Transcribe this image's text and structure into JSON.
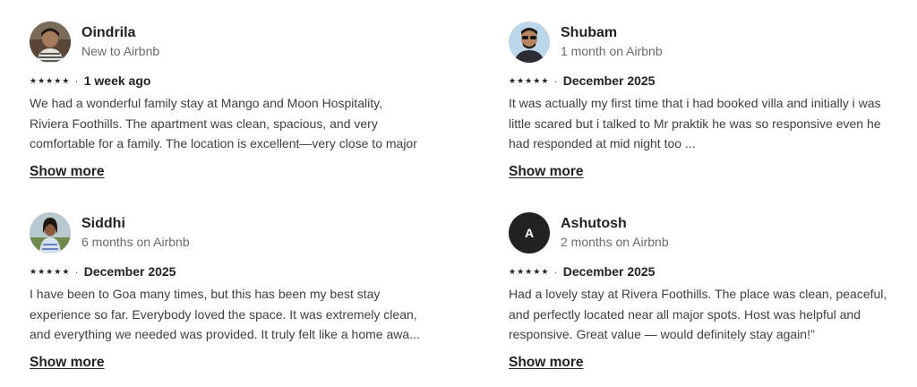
{
  "reviews": [
    {
      "name": "Oindrila",
      "tenure": "New to Airbnb",
      "rating": 5,
      "when": "1 week ago",
      "text": "We had a wonderful family stay at Mango and Moon Hospitality, Riviera Foothills. The apartment was clean, spacious, and very comfortable for a family. The location is excellent—very close to major beaches in ...",
      "more_label": "Show more",
      "avatar": "photo"
    },
    {
      "name": "Shubam",
      "tenure": "1 month on Airbnb",
      "rating": 5,
      "when": "December 2025",
      "text": "It was actually my first time that i had booked villa and initially i was little scared but i talked to Mr praktik he was so responsive even he had responded  at mid night too ...",
      "more_label": "Show more",
      "avatar": "photo"
    },
    {
      "name": "Siddhi",
      "tenure": "6 months on Airbnb",
      "rating": 5,
      "when": "December 2025",
      "text": "I have been to Goa many times, but this has been my best stay experience so far. Everybody loved the space. It was extremely clean, and everything we needed was provided. It truly felt like a home awa...",
      "more_label": "Show more",
      "avatar": "photo"
    },
    {
      "name": "Ashutosh",
      "tenure": "2 months on Airbnb",
      "rating": 5,
      "when": "December 2025",
      "text": "Had a lovely stay at Rivera Foothills. The place was clean, peaceful, and perfectly located near all major spots. Host was helpful and responsive. Great value — would definitely stay again!”",
      "more_label": "Show more",
      "avatar_letter": "A"
    }
  ],
  "star_glyph": "★",
  "separator": "·"
}
